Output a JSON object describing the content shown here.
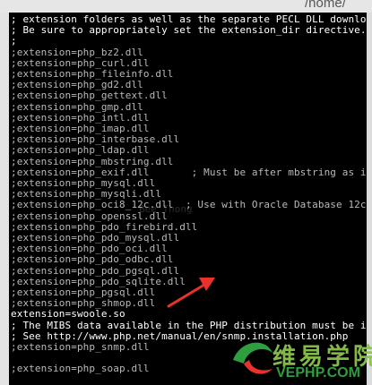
{
  "window": {
    "path_fragment": "/home/"
  },
  "terminal": {
    "lines": [
      {
        "text": "; extension folders as well as the separate PECL DLL download",
        "color": "#ffffff"
      },
      {
        "text": "; Be sure to appropriately set the extension_dir directive.",
        "color": "#ffffff"
      },
      {
        "text": ";",
        "color": "#ffffff"
      },
      {
        "text": ";extension=php_bz2.dll",
        "color": "#b9b9b9"
      },
      {
        "text": ";extension=php_curl.dll",
        "color": "#b9b9b9"
      },
      {
        "text": ";extension=php_fileinfo.dll",
        "color": "#b9b9b9"
      },
      {
        "text": ";extension=php_gd2.dll",
        "color": "#b9b9b9"
      },
      {
        "text": ";extension=php_gettext.dll",
        "color": "#b9b9b9"
      },
      {
        "text": ";extension=php_gmp.dll",
        "color": "#b9b9b9"
      },
      {
        "text": ";extension=php_intl.dll",
        "color": "#b9b9b9"
      },
      {
        "text": ";extension=php_imap.dll",
        "color": "#b9b9b9"
      },
      {
        "text": ";extension=php_interbase.dll",
        "color": "#b9b9b9"
      },
      {
        "text": ";extension=php_ldap.dll",
        "color": "#b9b9b9"
      },
      {
        "text": ";extension=php_mbstring.dll",
        "color": "#b9b9b9"
      },
      {
        "text": ";extension=php_exif.dll       ; Must be after mbstring as it",
        "color": "#b9b9b9"
      },
      {
        "text": ";extension=php_mysql.dll",
        "color": "#b9b9b9"
      },
      {
        "text": ";extension=php_mysqli.dll",
        "color": "#b9b9b9"
      },
      {
        "text": ";extension=php_oci8_12c.dll  ; Use with Oracle Database 12c",
        "color": "#b9b9b9"
      },
      {
        "text": ";extension=php_openssl.dll",
        "color": "#b9b9b9"
      },
      {
        "text": ";extension=php_pdo_firebird.dll",
        "color": "#b9b9b9"
      },
      {
        "text": ";extension=php_pdo_mysql.dll",
        "color": "#b9b9b9"
      },
      {
        "text": ";extension=php_pdo_oci.dll",
        "color": "#b9b9b9"
      },
      {
        "text": ";extension=php_pdo_odbc.dll",
        "color": "#b9b9b9"
      },
      {
        "text": ";extension=php_pdo_pgsql.dll",
        "color": "#b9b9b9"
      },
      {
        "text": ";extension=php_pdo_sqlite.dll",
        "color": "#b9b9b9"
      },
      {
        "text": ";extension=php_pgsql.dll",
        "color": "#b9b9b9"
      },
      {
        "text": ";extension=php_shmop.dll",
        "color": "#b9b9b9"
      },
      {
        "text": "extension=swoole.so",
        "color": "#ffffff"
      },
      {
        "text": "; The MIBS data available in the PHP distribution must be ins",
        "color": "#ffffff"
      },
      {
        "text": "; See http://www.php.net/manual/en/snmp.installation.php",
        "color": "#ffffff"
      },
      {
        "text": ";extension=php_snmp.dll",
        "color": "#b9b9b9"
      },
      {
        "text": "",
        "color": "#b9b9b9"
      },
      {
        "text": ";extension=php_soap.dll",
        "color": "#b9b9b9"
      }
    ]
  },
  "annotation": {
    "arrow_color": "#e8322b",
    "ghost_text": "Bee Thong"
  },
  "watermark": {
    "chinese": "维易学院",
    "english": "VEPHP.COM"
  }
}
